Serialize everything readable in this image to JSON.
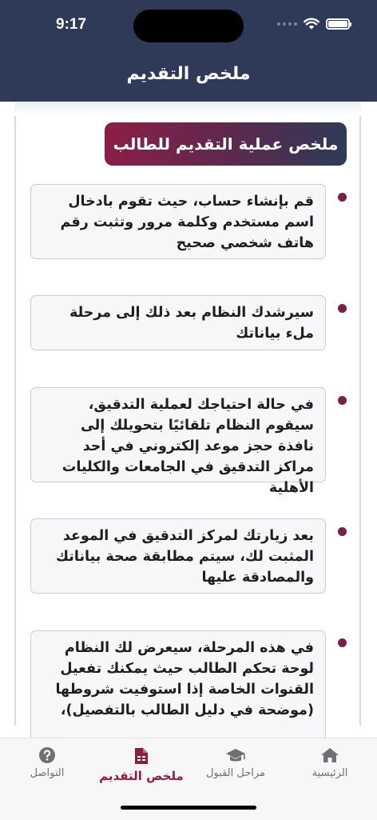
{
  "status_bar": {
    "time": "9:17"
  },
  "header": {
    "title": "ملخص التقديم"
  },
  "summary": {
    "title": "ملخص عملية التقديم للطالب"
  },
  "steps": [
    {
      "text": "قم بإنشاء حساب، حيث تقوم بادخال اسم مستخدم وكلمة مرور وتثبت رقم هاتف شخصي صحيح"
    },
    {
      "text": "سيرشدك النظام بعد ذلك إلى مرحلة ملء بياناتك"
    },
    {
      "text": "في حالة احتياجك لعملية التدقيق، سيقوم النظام تلقائيًا بتحويلك إلى نافذة حجز موعد إلكتروني في أحد مراكز التدقيق في الجامعات والكليات الأهلية"
    },
    {
      "text": "بعد زيارتك لمركز التدقيق في الموعد المثبت لك، سيتم مطابقة صحة بياناتك والمصادقة عليها"
    },
    {
      "text": "في هذه المرحلة، سيعرض لك النظام لوحة تحكم الطالب حيث يمكنك تفعيل القنوات الخاصة إذا استوفيت شروطها (موضحة في دليل الطالب بالتفصيل)،"
    }
  ],
  "tabs": [
    {
      "label": "التواصل",
      "icon": "help-icon"
    },
    {
      "label": "ملخص التقديم",
      "icon": "document-icon",
      "active": true
    },
    {
      "label": "مراحل القبول",
      "icon": "graduation-cap-icon"
    },
    {
      "label": "الرئيسية",
      "icon": "home-icon"
    }
  ],
  "colors": {
    "header": "#2e3a58",
    "accent": "#8c1e46"
  }
}
